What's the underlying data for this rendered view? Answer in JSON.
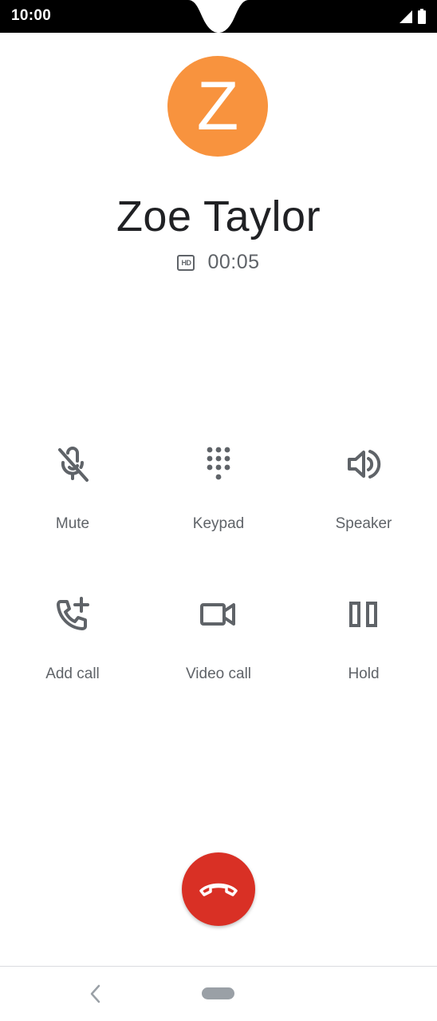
{
  "status_bar": {
    "time": "10:00",
    "icons": [
      "signal-icon",
      "battery-icon"
    ]
  },
  "caller": {
    "avatar_letter": "Z",
    "avatar_color": "#f8933e",
    "name": "Zoe Taylor",
    "hd_icon": "hd-icon",
    "hd_text": "HD",
    "duration": "00:05"
  },
  "controls": [
    {
      "id": "mute",
      "label": "Mute",
      "icon": "mic-off-icon"
    },
    {
      "id": "keypad",
      "label": "Keypad",
      "icon": "dialpad-icon"
    },
    {
      "id": "speaker",
      "label": "Speaker",
      "icon": "volume-icon"
    },
    {
      "id": "add-call",
      "label": "Add call",
      "icon": "add-call-icon"
    },
    {
      "id": "video-call",
      "label": "Video call",
      "icon": "videocam-icon"
    },
    {
      "id": "hold",
      "label": "Hold",
      "icon": "pause-icon"
    }
  ],
  "end_call": {
    "icon": "call-end-icon",
    "color": "#d93025"
  },
  "nav": {
    "back_icon": "back-icon",
    "home_icon": "home-pill-icon"
  },
  "colors": {
    "icon_gray": "#5f6368",
    "name_text": "#202124",
    "status_bar": "#000000"
  }
}
